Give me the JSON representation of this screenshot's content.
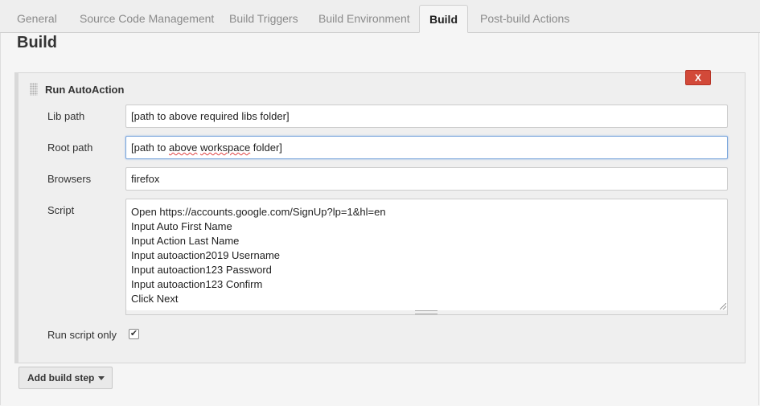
{
  "tabs": [
    {
      "label": "General",
      "active": false
    },
    {
      "label": "Source Code Management",
      "active": false
    },
    {
      "label": "Build Triggers",
      "active": false
    },
    {
      "label": "Build Environment",
      "active": false
    },
    {
      "label": "Build",
      "active": true
    },
    {
      "label": "Post-build Actions",
      "active": false
    }
  ],
  "section_title": "Build",
  "step": {
    "title": "Run AutoAction",
    "delete_label": "X",
    "fields": {
      "lib_path": {
        "label": "Lib path",
        "value": "[path to above required libs folder]"
      },
      "root_path": {
        "label": "Root path",
        "value_prefix": "[path to ",
        "value_above": "above",
        "value_mid": " ",
        "value_workspace": "workspace",
        "value_suffix": " folder]"
      },
      "browsers": {
        "label": "Browsers",
        "value": "firefox"
      },
      "script": {
        "label": "Script",
        "lines": [
          "Open https://accounts.google.com/SignUp?lp=1&hl=en",
          "Input Auto First Name",
          "Input Action Last Name",
          "Input autoaction2019 Username",
          "Input autoaction123 Password",
          "Input autoaction123 Confirm",
          "Click Next"
        ]
      },
      "run_script_only": {
        "label": "Run script only",
        "checked": true,
        "check_glyph": "✔"
      }
    }
  },
  "add_build_step": {
    "label": "Add build step",
    "icon": "caret-down-icon"
  },
  "colors": {
    "delete": "#d24939",
    "focus": "#7aa6dc",
    "background": "#f5f5f5"
  }
}
